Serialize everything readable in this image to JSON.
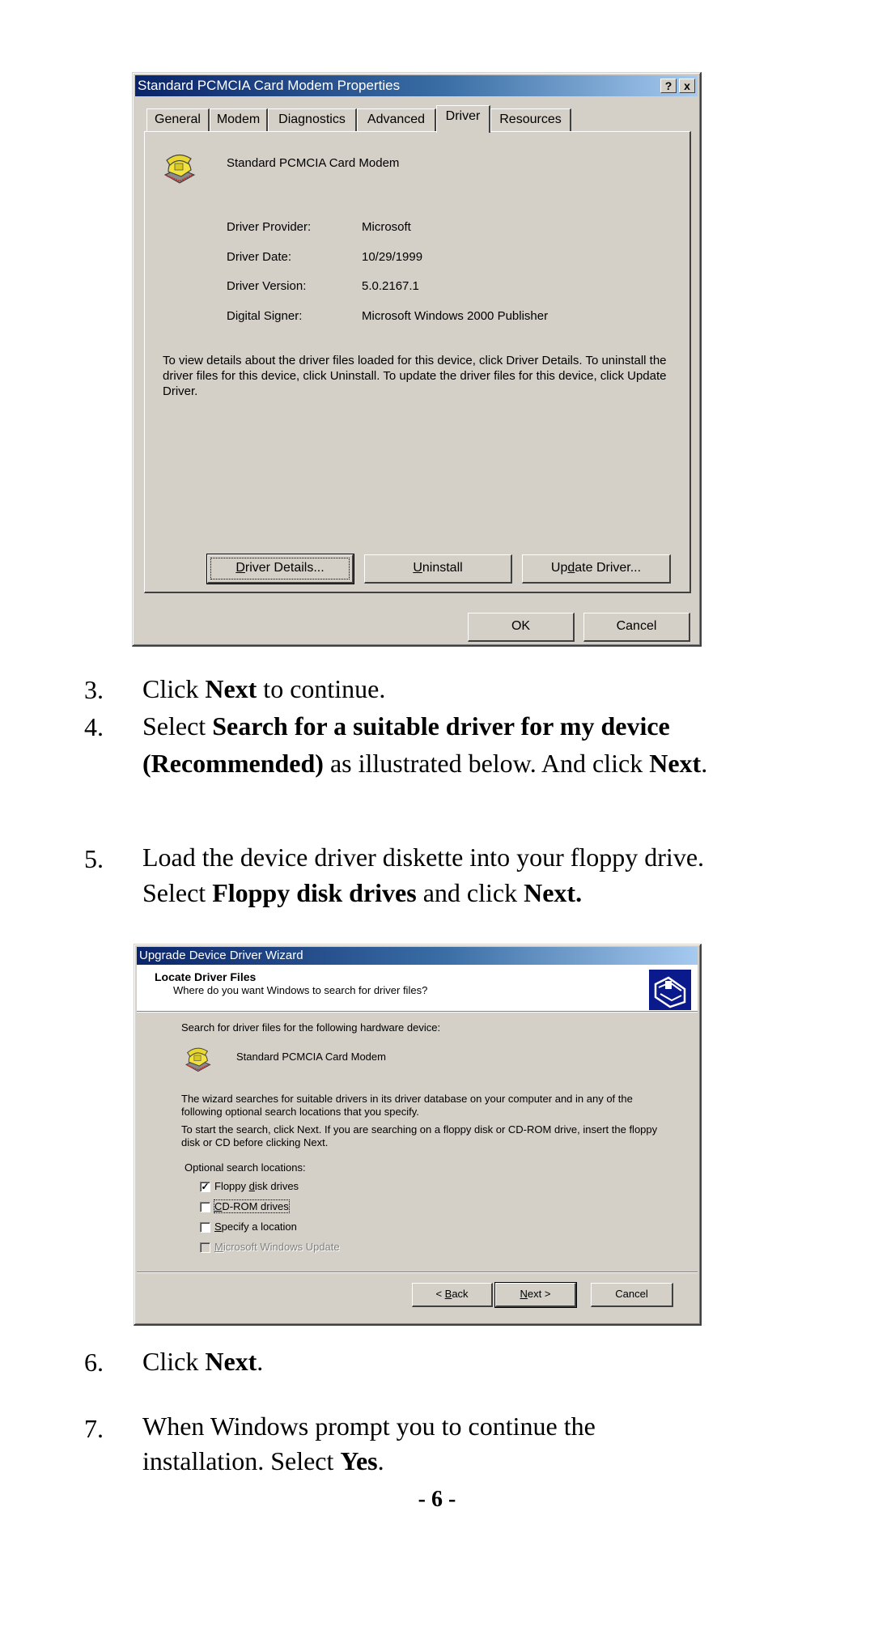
{
  "dialog1": {
    "title": "Standard PCMCIA Card Modem Properties",
    "help_label": "?",
    "close_label": "x",
    "tabs": [
      {
        "label": "General"
      },
      {
        "label": "Modem"
      },
      {
        "label": "Diagnostics"
      },
      {
        "label": "Advanced"
      },
      {
        "label": "Driver",
        "active": true
      },
      {
        "label": "Resources"
      }
    ],
    "device_name": "Standard PCMCIA Card Modem",
    "fields": [
      {
        "label": "Driver Provider:",
        "value": "Microsoft"
      },
      {
        "label": "Driver Date:",
        "value": "10/29/1999"
      },
      {
        "label": "Driver Version:",
        "value": "5.0.2167.1"
      },
      {
        "label": "Digital Signer:",
        "value": "Microsoft Windows 2000 Publisher"
      }
    ],
    "description": "To view details about the driver files loaded for this device, click Driver Details. To uninstall the driver files for this device, click Uninstall. To update the driver files for this device, click Update Driver.",
    "buttons": {
      "driver_details": {
        "mnemonic": "D",
        "rest": "river Details..."
      },
      "uninstall": {
        "mnemonic": "U",
        "rest": "ninstall"
      },
      "update_driver": {
        "pre": "Up",
        "mnemonic": "d",
        "rest": "ate Driver..."
      },
      "ok": "OK",
      "cancel": "Cancel"
    }
  },
  "steps_a": [
    {
      "num": "3.",
      "parts": [
        {
          "t": "Click "
        },
        {
          "t": "Next",
          "b": true
        },
        {
          "t": " to continue."
        }
      ]
    },
    {
      "num": "4.",
      "parts": [
        {
          "t": "Select "
        },
        {
          "t": "Search for a suitable driver for my device (Recommended)",
          "b": true
        },
        {
          "t": " as illustrated below. And click "
        },
        {
          "t": "Next",
          "b": true
        },
        {
          "t": "."
        }
      ]
    },
    {
      "num": "5.",
      "parts": [
        {
          "t": "Load the device driver diskette into your floppy drive. Select "
        },
        {
          "t": "Floppy disk drives",
          "b": true
        },
        {
          "t": " and click "
        },
        {
          "t": "Next.",
          "b": true
        }
      ]
    }
  ],
  "dialog2": {
    "title": "Upgrade Device Driver Wizard",
    "header_title": "Locate Driver Files",
    "header_subtitle": "Where do you want Windows to search for driver files?",
    "intro": "Search for driver files for the following hardware device:",
    "device_name": "Standard PCMCIA Card Modem",
    "para1": "The wizard searches for suitable drivers in its driver database on your computer and in any of the following optional search locations that you specify.",
    "para2": "To start the search, click Next. If you are searching on a floppy disk or CD-ROM drive, insert the floppy disk or CD before clicking Next.",
    "options_label": "Optional search locations:",
    "options": [
      {
        "pre": "Floppy ",
        "mnemonic": "d",
        "rest": "isk drives",
        "checked": true,
        "disabled": false
      },
      {
        "pre": "",
        "mnemonic": "C",
        "rest": "D-ROM drives",
        "checked": false,
        "disabled": false,
        "focused": true
      },
      {
        "pre": "",
        "mnemonic": "S",
        "rest": "pecify a location",
        "checked": false,
        "disabled": false
      },
      {
        "pre": "",
        "mnemonic": "M",
        "rest": "icrosoft Windows Update",
        "checked": false,
        "disabled": true
      }
    ],
    "buttons": {
      "back": {
        "pre": "< ",
        "mnemonic": "B",
        "rest": "ack"
      },
      "next": {
        "pre": "",
        "mnemonic": "N",
        "rest": "ext >"
      },
      "cancel": "Cancel"
    }
  },
  "steps_b": [
    {
      "num": "6.",
      "parts": [
        {
          "t": "Click "
        },
        {
          "t": "Next",
          "b": true
        },
        {
          "t": "."
        }
      ]
    },
    {
      "num": "7.",
      "parts": [
        {
          "t": "When Windows prompt you to continue the installation.  Select "
        },
        {
          "t": "Yes",
          "b": true
        },
        {
          "t": "."
        }
      ]
    }
  ],
  "page_number": "- 6 -"
}
